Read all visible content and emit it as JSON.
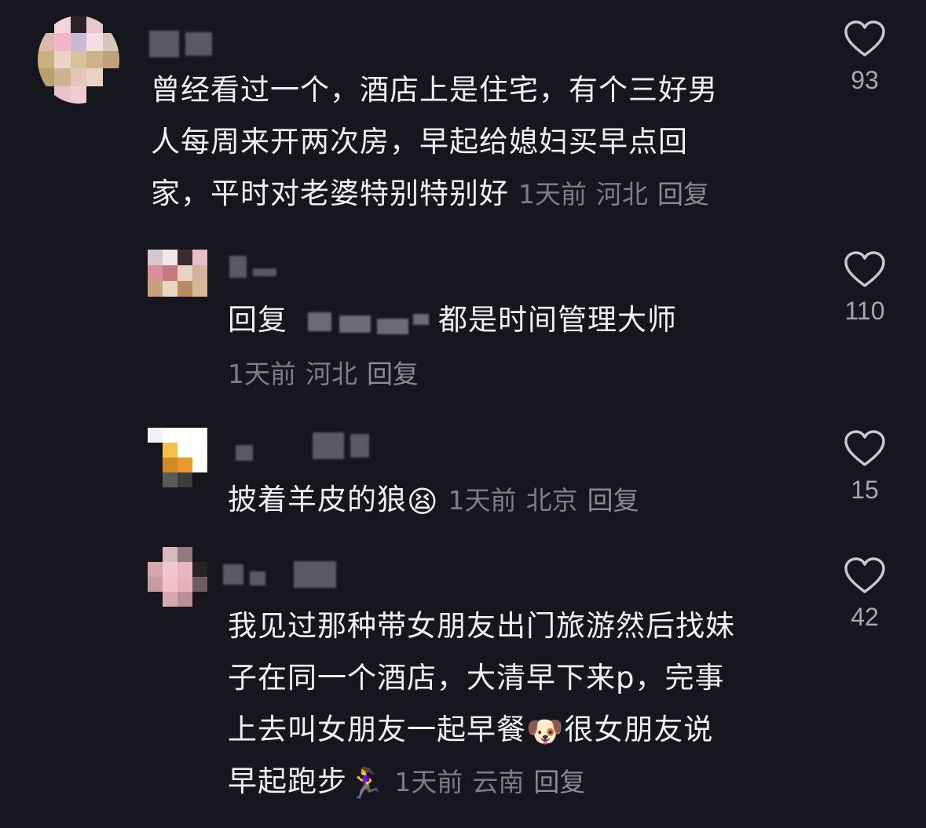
{
  "comments": [
    {
      "text_lines": [
        "曾经看过一个，酒店上是住宅，有个三好男",
        "人每周来开两次房，早起给媳妇买早点回",
        "家，平时对老婆特别特别好"
      ],
      "time": "1天前",
      "location": "河北",
      "reply_label": "回复",
      "likes": "93"
    },
    {
      "reply_prefix": "回复",
      "text": "都是时间管理大师",
      "time": "1天前",
      "location": "河北",
      "reply_label": "回复",
      "likes": "110"
    },
    {
      "text": "披着羊皮的狼",
      "emoji": "😫",
      "time": "1天前",
      "location": "北京",
      "reply_label": "回复",
      "likes": "15"
    },
    {
      "text_lines": [
        "我见过那种带女朋友出门旅游然后找妹",
        "子在同一个酒店，大清早下来p，完事",
        "上去叫女朋友一起早餐",
        "很女朋友说",
        "早起跑步"
      ],
      "emoji_mid": "🐶",
      "emoji_end": "🏃‍♀️",
      "time": "1天前",
      "location": "云南",
      "reply_label": "回复",
      "likes": "42"
    }
  ],
  "icons": {
    "like": "heart-outline-icon"
  },
  "colors": {
    "background": "#16161e",
    "text": "#f0f0f4",
    "meta": "#7d7d87",
    "like_count": "#a7a7b0"
  }
}
